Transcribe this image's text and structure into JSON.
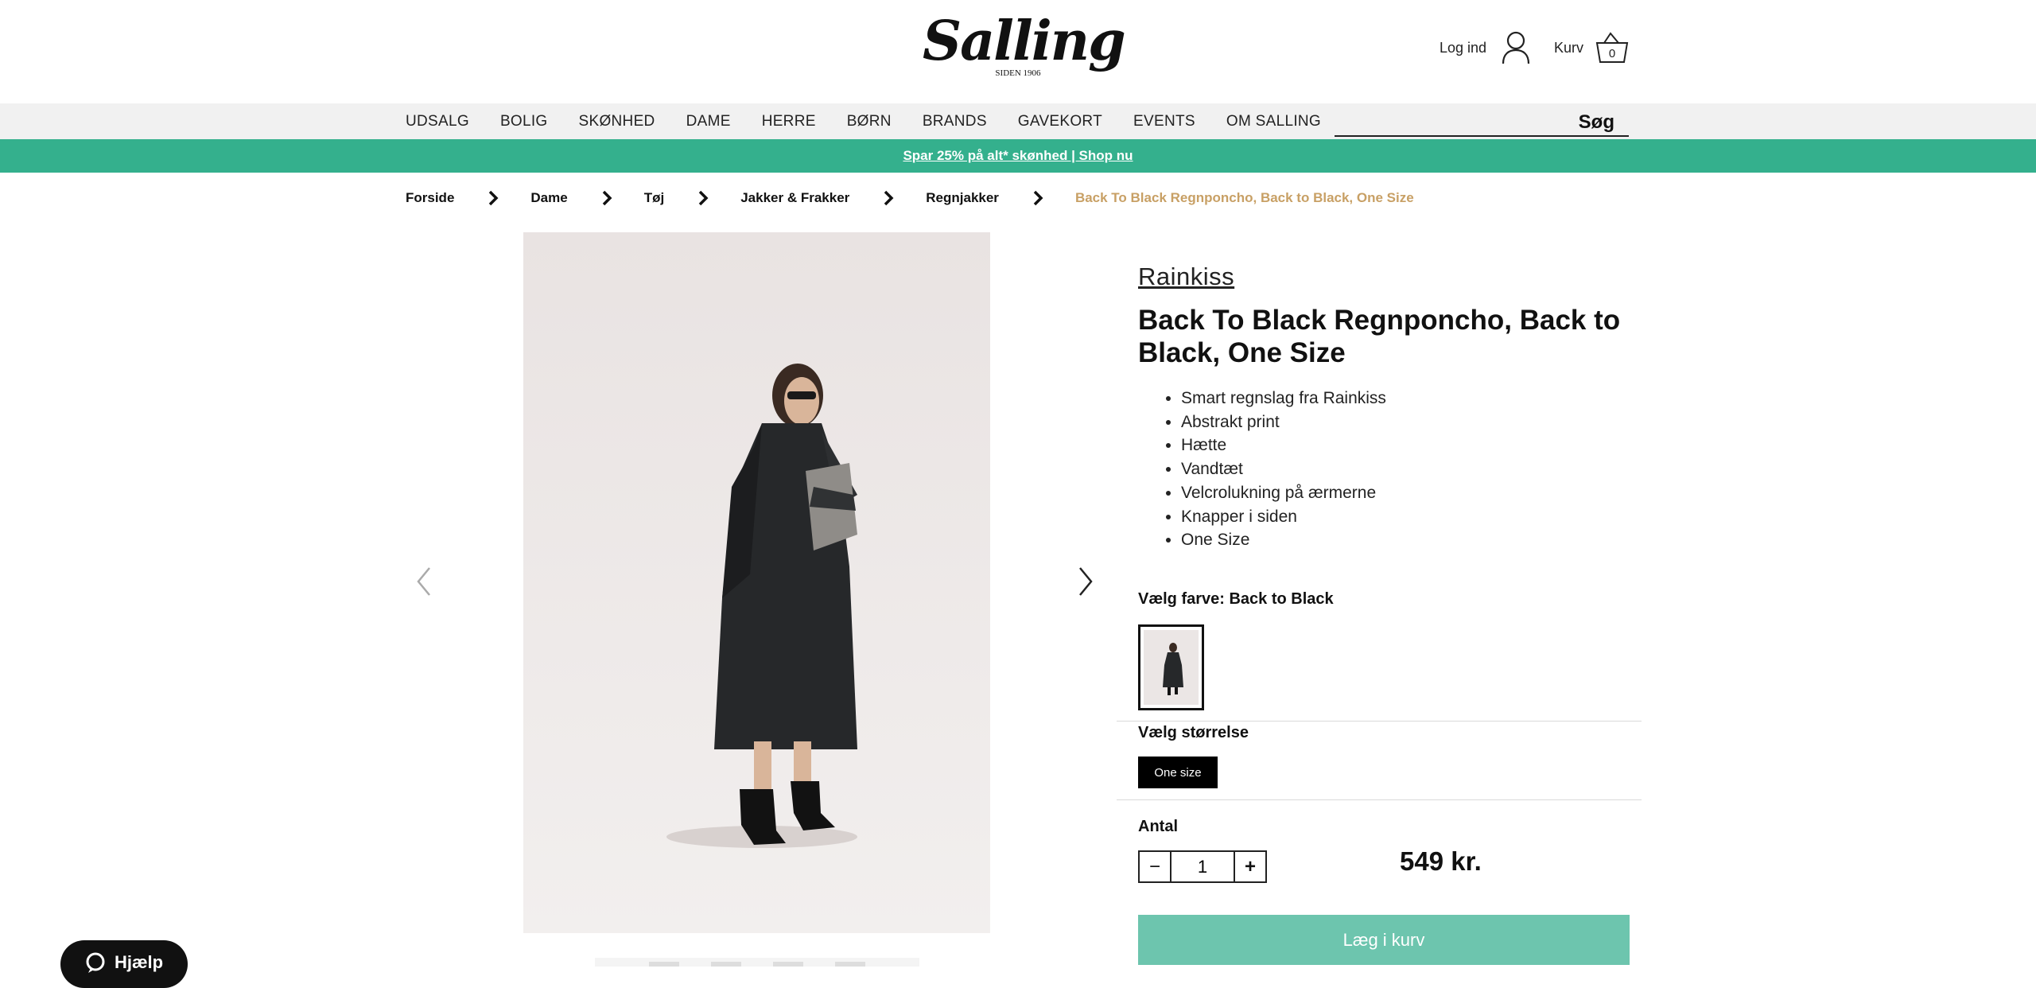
{
  "header": {
    "logo_text": "Salling",
    "logo_subtitle": "SIDEN 1906",
    "login_label": "Log ind",
    "cart_label": "Kurv",
    "cart_count": "0"
  },
  "nav": {
    "items": [
      "UDSALG",
      "BOLIG",
      "SKØNHED",
      "DAME",
      "HERRE",
      "BØRN",
      "BRANDS",
      "GAVEKORT",
      "EVENTS",
      "OM SALLING"
    ],
    "search_placeholder": "",
    "search_button": "Søg"
  },
  "promo": {
    "text": "Spar 25% på alt* skønhed | Shop nu"
  },
  "breadcrumb": {
    "items": [
      "Forside",
      "Dame",
      "Tøj",
      "Jakker & Frakker",
      "Regnjakker"
    ],
    "current": "Back To Black Regnponcho, Back to Black, One Size"
  },
  "product": {
    "brand": "Rainkiss",
    "title": "Back To Black Regnponcho, Back to Black, One Size",
    "features": [
      "Smart regnslag fra Rainkiss",
      "Abstrakt print",
      "Hætte",
      "Vandtæt",
      "Velcrolukning på ærmerne",
      "Knapper i siden",
      "One Size"
    ],
    "color_label": "Vælg farve: Back to Black",
    "size_label": "Vælg størrelse",
    "size_option": "One size",
    "qty_label": "Antal",
    "qty_value": "1",
    "qty_minus": "−",
    "qty_plus": "+",
    "price": "549 kr.",
    "add_to_cart": "Læg i kurv"
  },
  "help": {
    "label": "Hjælp"
  },
  "colors": {
    "promo_green": "#34b08d",
    "add_to_cart_green": "#6dc5ae",
    "breadcrumb_current": "#c8a065",
    "nav_bg": "#f1f1f1"
  }
}
